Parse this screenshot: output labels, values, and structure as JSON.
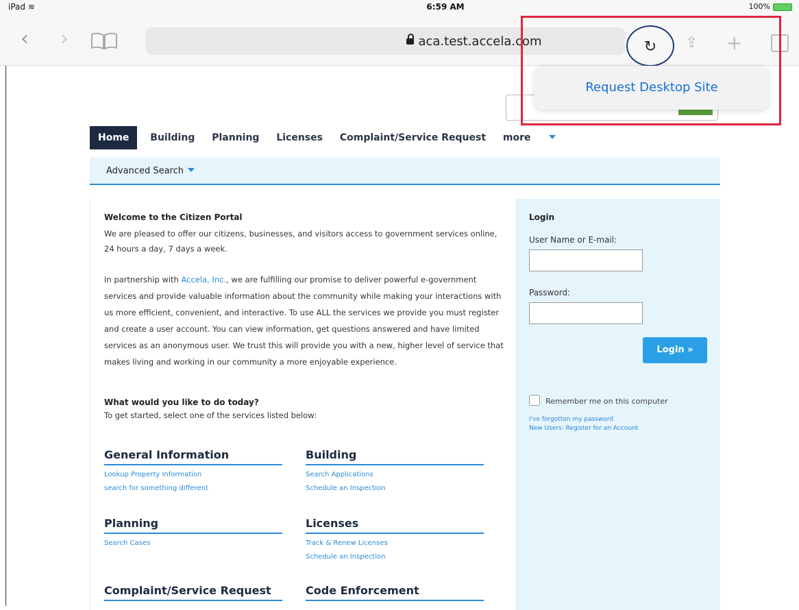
{
  "status": {
    "device": "iPad",
    "wifi": "wifi-icon",
    "time": "6:59 AM",
    "battery": "100%"
  },
  "browser": {
    "url": "aca.test.accela.com",
    "popover_label": "Request Desktop Site"
  },
  "nav": {
    "items": [
      "Home",
      "Building",
      "Planning",
      "Licenses",
      "Complaint/Service Request",
      "more"
    ],
    "advanced_search": "Advanced Search"
  },
  "welcome": {
    "title": "Welcome to the Citizen Portal",
    "intro": "We are pleased to offer our citizens, businesses, and visitors access to government services online, 24 hours a day, 7 days a week.",
    "p2_before": "In partnership with ",
    "p2_link": "Accela, Inc.",
    "p2_after": ", we are fulfilling our promise to deliver powerful e-government services and provide valuable information about the community while making your interactions with us more efficient, convenient, and interactive. To use ALL the services we provide you must register and create a user account. You can view information, get questions answered and have limited services as an anonymous user. We trust this will provide you with a new, higher level of service that makes living and working in our community a more enjoyable experience."
  },
  "question": {
    "title": "What would you like to do today?",
    "subtitle": "To get started, select one of the services listed below:"
  },
  "sections": [
    {
      "title": "General Information",
      "items": [
        "Lookup Property Information",
        "search for something different"
      ]
    },
    {
      "title": "Building",
      "items": [
        "Search Applications",
        "Schedule an Inspection"
      ]
    },
    {
      "title": "Planning",
      "items": [
        "Search Cases"
      ]
    },
    {
      "title": "Licenses",
      "items": [
        "Track & Renew Licenses",
        "Schedule an Inspection"
      ]
    },
    {
      "title": "Complaint/Service Request",
      "items": []
    },
    {
      "title": "Code Enforcement",
      "items": []
    }
  ],
  "login": {
    "title": "Login",
    "username_label": "User Name or E-mail:",
    "password_label": "Password:",
    "button": "Login »",
    "remember": "Remember me on this computer",
    "forgot": "I've forgotten my password",
    "register": "New Users: Register for an Account"
  },
  "colors": {
    "highlight": "#e0253a",
    "accent": "#2a8ad9",
    "nav_dark": "#1c2a40"
  }
}
